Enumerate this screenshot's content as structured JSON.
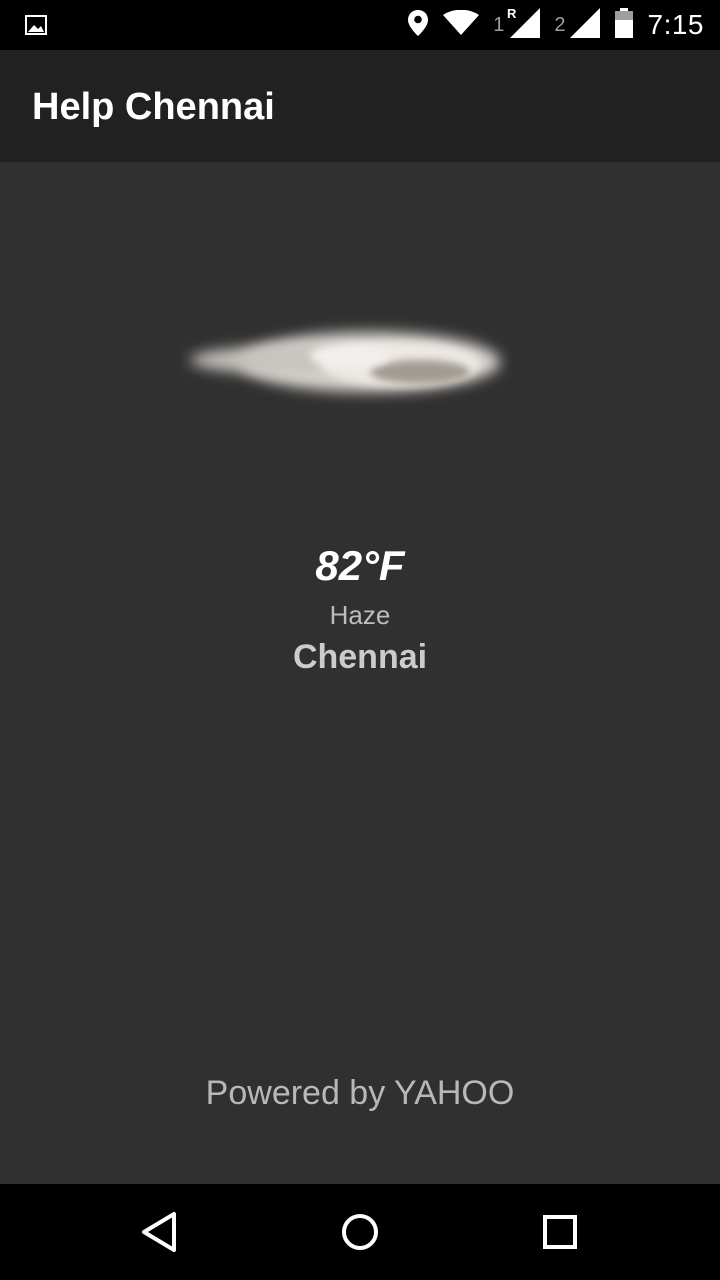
{
  "status_bar": {
    "sim1_label": "1",
    "sim1_roaming": "R",
    "sim2_label": "2",
    "time": "7:15",
    "icons": [
      "image-notification-icon",
      "location-icon",
      "wifi-icon",
      "signal-icon",
      "battery-icon"
    ]
  },
  "app_bar": {
    "title": "Help Chennai"
  },
  "weather": {
    "temperature": "82°F",
    "condition": "Haze",
    "city": "Chennai",
    "icon": "cloud-icon"
  },
  "footer": {
    "powered_by": "Powered by YAHOO"
  },
  "nav_bar": {
    "icons": [
      "back-icon",
      "home-icon",
      "recents-icon"
    ]
  },
  "colors": {
    "status_bar_bg": "#000000",
    "app_bar_bg": "#212121",
    "content_bg": "#303030",
    "nav_bar_bg": "#000000"
  }
}
